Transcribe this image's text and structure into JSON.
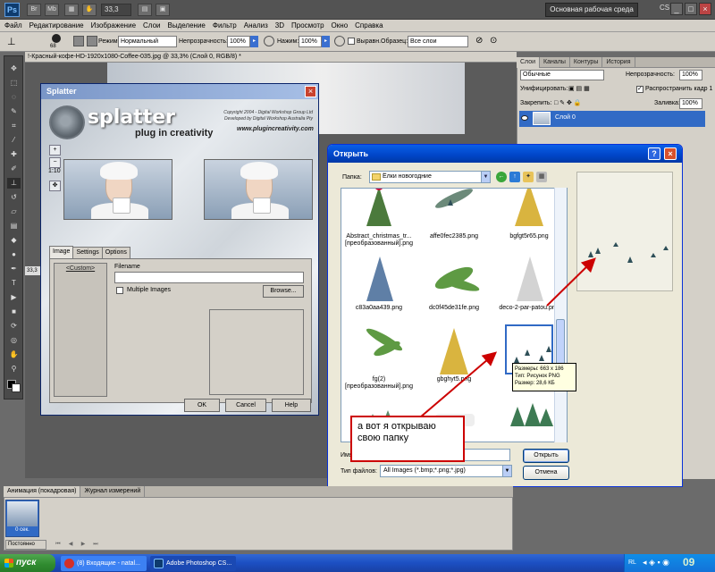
{
  "app": {
    "logo": "Ps",
    "zoom": "33,3",
    "workspace_button": "Основная рабочая среда",
    "cs_live": "CS",
    "window_controls": [
      "_",
      "□",
      "×"
    ]
  },
  "menu": [
    "Файл",
    "Редактирование",
    "Изображение",
    "Слои",
    "Выделение",
    "Фильтр",
    "Анализ",
    "3D",
    "Просмотр",
    "Окно",
    "Справка"
  ],
  "options_bar": {
    "brush_size": "68",
    "mode_label": "Режим:",
    "mode_value": "Нормальный",
    "opacity_label": "Непрозрачность:",
    "opacity_value": "100%",
    "flow_label": "Нажим:",
    "flow_value": "100%",
    "aligned_label": "Выравн.",
    "sample_label": "Образец:",
    "sample_value": "Все слои"
  },
  "document": {
    "tab_title": "!-Красный-кофе-HD-1920x1080-Coffee-035.jpg @ 33,3% (Слой 0, RGB/8) *",
    "status_zoom": "33,3"
  },
  "layers_panel": {
    "tabs": [
      "Слои",
      "Каналы",
      "Контуры",
      "История"
    ],
    "blend_mode": "Обычные",
    "opacity_label": "Непрозрачность:",
    "opacity_value": "100%",
    "unify_label": "Унифицировать:",
    "propagate_label": "Распространить кадр 1",
    "lock_label": "Закрепить:",
    "fill_label": "Заливка:",
    "fill_value": "100%",
    "layer_name": "Слой 0"
  },
  "splatter": {
    "title": "Splatter",
    "close": "×",
    "brand": "splatter",
    "tagline": "plug in creativity",
    "copyright": "Copyright 2004 - Digital Workshop Group Ltd Developed by Digital Workshop Australia Pty",
    "url": "www.plugincreativity.com",
    "zoom_in": "+",
    "zoom_out": "−",
    "ratio": "1:10",
    "hand": "✥",
    "tabs": [
      "Image",
      "Settings",
      "Options"
    ],
    "list_item": "<Custom>",
    "filename_label": "Filename",
    "multiple_label": "Multiple Images",
    "browse": "Browse...",
    "ok": "OK",
    "cancel": "Cancel",
    "help": "Help"
  },
  "open_dialog": {
    "title": "Открыть",
    "help": "?",
    "close": "×",
    "folder_label": "Папка:",
    "folder_value": "Ёлки новогодние",
    "files": [
      {
        "name": "Abstract_christmas_tr... [преобразованный].png"
      },
      {
        "name": "affe0fec2385.png"
      },
      {
        "name": "bgfgt5r65.png"
      },
      {
        "name": "c83a0aa439.png"
      },
      {
        "name": "dc0f45de31fe.png"
      },
      {
        "name": "deco-2-par-patou.png"
      },
      {
        "name": "fg(2) [преобразованный].png"
      },
      {
        "name": "gbghyt5.png"
      },
      {
        "name": "hgtgf"
      },
      {
        "name": ""
      },
      {
        "name": ""
      },
      {
        "name": ""
      }
    ],
    "tooltip": [
      "Размеры: 663 x 186",
      "Тип: Рисунок PNG",
      "Размер: 28,6 КБ"
    ],
    "filename_label": "Имя",
    "filetype_label": "Тип файлов:",
    "filetype_value": "All Images (*.bmp;*.png;*.jpg)",
    "open_button": "Открыть",
    "cancel_button": "Отмена"
  },
  "annotation": {
    "text": "а вот я открываю свою папку",
    "color": "#cc0000"
  },
  "animation_panel": {
    "tabs": [
      "Анимация (покадровая)",
      "Журнал измерений"
    ],
    "frame_time": "0 сек.",
    "loop": "Постоянно",
    "controls": [
      "⏮",
      "◀",
      "▶",
      "⏭"
    ]
  },
  "taskbar": {
    "start": "пуск",
    "tasks": [
      "(8) Входящие - natal...",
      "Adobe Photoshop CS..."
    ],
    "lang": "RL",
    "clock": "09"
  }
}
